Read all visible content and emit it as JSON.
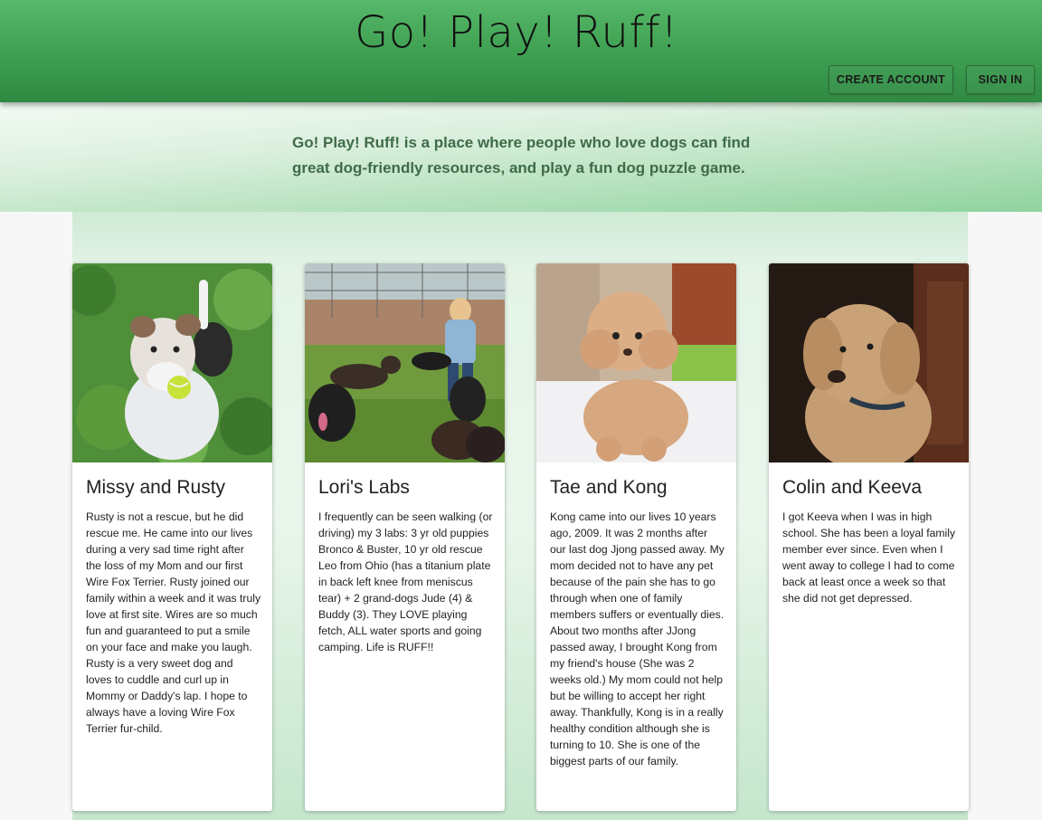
{
  "header": {
    "title": "Go! Play! Ruff!",
    "create_account_label": "CREATE ACCOUNT",
    "sign_in_label": "SIGN IN"
  },
  "hero": {
    "tagline": "Go! Play! Ruff! is a place where people who love dogs can find great dog-friendly resources, and play a fun dog puzzle game."
  },
  "cards": [
    {
      "title": "Missy and Rusty",
      "text": "Rusty is not a rescue, but he did rescue me. He came into our lives during a very sad time right after the loss of my Mom and our first Wire Fox Terrier. Rusty joined our family within a week and it was truly love at first site. Wires are so much fun and guaranteed to put a smile on your face and make you laugh. Rusty is a very sweet dog and loves to cuddle and curl up in Mommy or Daddy's lap. I hope to always have a loving Wire Fox Terrier fur-child."
    },
    {
      "title": "Lori's Labs",
      "text": "I frequently can be seen walking (or driving) my 3 labs: 3 yr old puppies Bronco & Buster, 10 yr old rescue Leo from Ohio (has a titanium plate in back left knee from meniscus tear) + 2 grand-dogs Jude (4) & Buddy (3). They LOVE playing fetch, ALL water sports and going camping. Life is RUFF!!"
    },
    {
      "title": "Tae and Kong",
      "text": "Kong came into our lives 10 years ago, 2009. It was 2 months after our last dog Jjong passed away. My mom decided not to have any pet because of the pain she has to go through when one of family members suffers or eventually dies. About two months after JJong passed away, I brought Kong from my friend's house (She was 2 weeks old.) My mom could not help but be willing to accept her right away. Thankfully, Kong is in a really healthy condition although she is turning to 10. She is one of the biggest parts of our family."
    },
    {
      "title": "Colin and Keeva",
      "text": "I got Keeva when I was in high school. She has been a loyal family member ever since. Even when I went away to college I had to come back at least once a week so that she did not get depressed."
    }
  ],
  "colors": {
    "header_green": "#3d9e50",
    "hero_green": "#bfe5c6",
    "text_dark": "#222222"
  }
}
